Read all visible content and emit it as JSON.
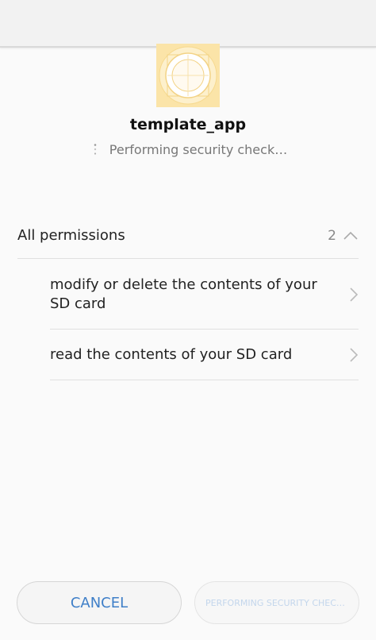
{
  "app": {
    "name": "template_app",
    "icon": "app-icon",
    "icon_color": "#fbe4a8"
  },
  "status": {
    "text": "Performing security check…",
    "icon": "loading-spinner-icon"
  },
  "permissions": {
    "header_label": "All permissions",
    "count": "2",
    "expanded_icon": "chevron-up-icon",
    "items": [
      {
        "label": "modify or delete the contents of your SD card",
        "icon": "chevron-right-icon"
      },
      {
        "label": "read the contents of your SD card",
        "icon": "chevron-right-icon"
      }
    ]
  },
  "buttons": {
    "cancel_label": "CANCEL",
    "continue_label": "PERFORMING SECURITY CHECK…",
    "accent_color": "#3f7fc8"
  }
}
